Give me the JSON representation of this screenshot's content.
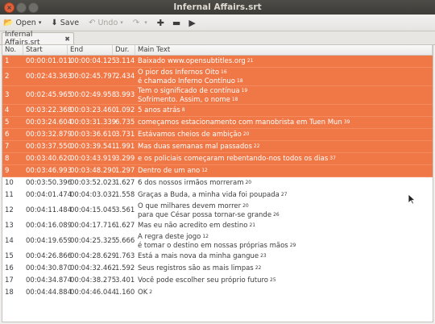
{
  "window": {
    "title": "Infernal Affairs.srt"
  },
  "toolbar": {
    "open_label": "Open",
    "save_label": "Save",
    "undo_label": "Undo"
  },
  "tab": {
    "label": "Infernal Affairs.srt"
  },
  "columns": {
    "no": "No.",
    "start": "Start",
    "end": "End",
    "dur": "Dur.",
    "text": "Main Text"
  },
  "colors": {
    "selection": "#f07746",
    "titlebar": "#3d3c38"
  },
  "rows": [
    {
      "no": "1",
      "start": "00:00:01.011",
      "end": "00:00:04.125",
      "dur": "3.114",
      "lines": [
        "Baixado www.opensubtitles.org"
      ],
      "count": "21",
      "sel": true
    },
    {
      "no": "2",
      "start": "00:02:43.363",
      "end": "00:02:45.797",
      "dur": "2.434",
      "lines": [
        "O pior dos Infernos Oito",
        "é chamado Inferno Contínuo"
      ],
      "count": "16",
      "count2": "18",
      "sel": true
    },
    {
      "no": "3",
      "start": "00:02:45.965",
      "end": "00:02:49.958",
      "dur": "3.993",
      "lines": [
        "Tem o significado de contínua",
        "Sofrimento. Assim, o nome"
      ],
      "count": "19",
      "count2": "18",
      "sel": true
    },
    {
      "no": "4",
      "start": "00:03:22.368",
      "end": "00:03:23.460",
      "dur": "1.092",
      "lines": [
        "5 anos atrás"
      ],
      "count": "8",
      "sel": true
    },
    {
      "no": "5",
      "start": "00:03:24.604",
      "end": "00:03:31.339",
      "dur": "6.735",
      "lines": [
        "começamos estacionamento com manobrista em Tuen Mun"
      ],
      "count": "39",
      "sel": true
    },
    {
      "no": "6",
      "start": "00:03:32.879",
      "end": "00:03:36.610",
      "dur": "3.731",
      "lines": [
        "Estávamos cheios de ambição"
      ],
      "count": "20",
      "sel": true
    },
    {
      "no": "7",
      "start": "00:03:37.550",
      "end": "00:03:39.541",
      "dur": "1.991",
      "lines": [
        "Mas duas semanas mal passados"
      ],
      "count": "22",
      "sel": true
    },
    {
      "no": "8",
      "start": "00:03:40.620",
      "end": "00:03:43.919",
      "dur": "3.299",
      "lines": [
        "e os policiais começaram rebentando-nos todos os dias"
      ],
      "count": "37",
      "sel": true
    },
    {
      "no": "9",
      "start": "00:03:46.993",
      "end": "00:03:48.290",
      "dur": "1.297",
      "lines": [
        "Dentro de um ano"
      ],
      "count": "12",
      "sel": true
    },
    {
      "no": "10",
      "start": "00:03:50.396",
      "end": "00:03:52.023",
      "dur": "1.627",
      "lines": [
        "6 dos nossos irmãos morreram"
      ],
      "count": "20",
      "sel": false
    },
    {
      "no": "11",
      "start": "00:04:01.474",
      "end": "00:04:03.032",
      "dur": "1.558",
      "lines": [
        "Graças a Buda, a minha vida foi poupada"
      ],
      "count": "27",
      "sel": false
    },
    {
      "no": "12",
      "start": "00:04:11.484",
      "end": "00:04:15.045",
      "dur": "3.561",
      "lines": [
        "O que milhares devem morrer",
        "para que César possa tornar-se grande"
      ],
      "count": "20",
      "count2": "26",
      "sel": false
    },
    {
      "no": "13",
      "start": "00:04:16.089",
      "end": "00:04:17.716",
      "dur": "1.627",
      "lines": [
        "Mas eu não acredito em destino"
      ],
      "count": "21",
      "sel": false
    },
    {
      "no": "14",
      "start": "00:04:19.659",
      "end": "00:04:25.325",
      "dur": "5.666",
      "lines": [
        "A regra deste jogo",
        "é tomar o destino em nossas próprias mãos"
      ],
      "count": "12",
      "count2": "29",
      "sel": false
    },
    {
      "no": "15",
      "start": "00:04:26.866",
      "end": "00:04:28.629",
      "dur": "1.763",
      "lines": [
        "Está a mais nova da minha gangue"
      ],
      "count": "23",
      "sel": false
    },
    {
      "no": "16",
      "start": "00:04:30.870",
      "end": "00:04:32.462",
      "dur": "1.592",
      "lines": [
        "Seus registros são as mais limpas"
      ],
      "count": "22",
      "sel": false
    },
    {
      "no": "17",
      "start": "00:04:34.874",
      "end": "00:04:38.275",
      "dur": "3.401",
      "lines": [
        "Você pode escolher seu próprio futuro"
      ],
      "count": "25",
      "sel": false
    },
    {
      "no": "18",
      "start": "00:04:44.884",
      "end": "00:04:46.044",
      "dur": "1.160",
      "lines": [
        "OK"
      ],
      "count": "2",
      "sel": false
    }
  ]
}
